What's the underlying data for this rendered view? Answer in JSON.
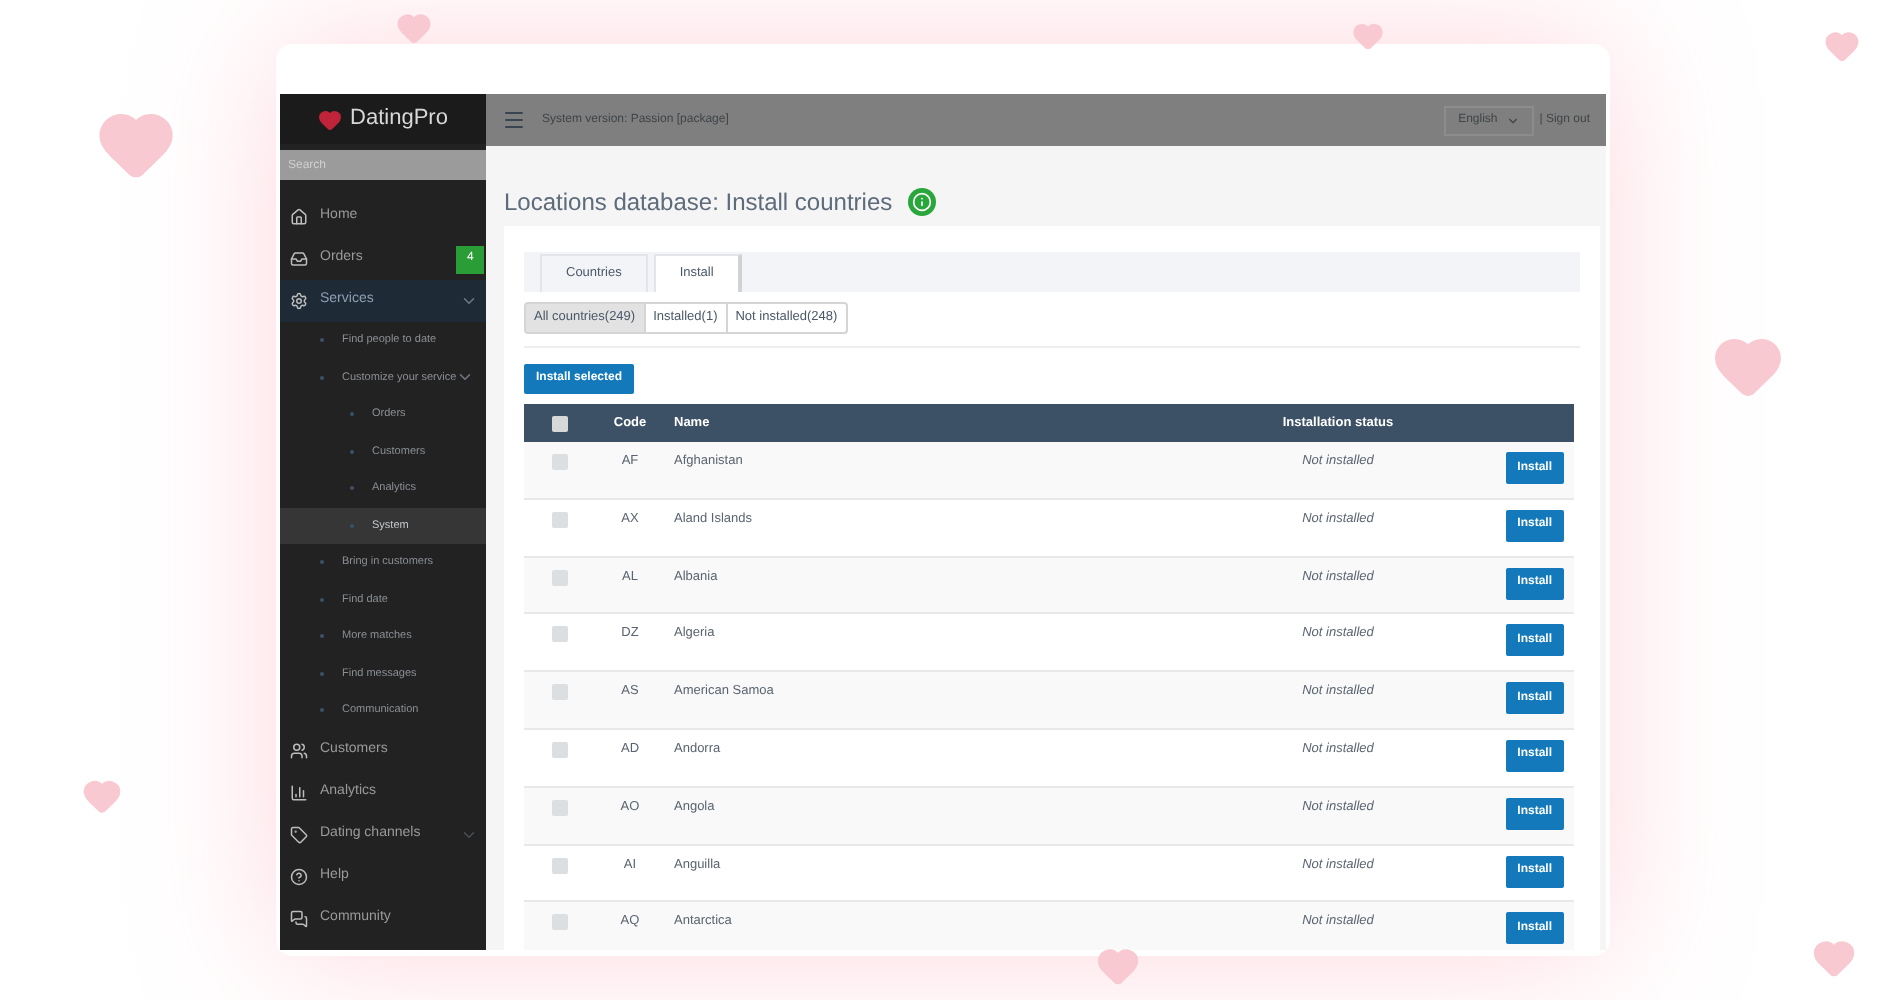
{
  "sidebar": {
    "logo": "DatingPro",
    "search": {
      "placeholder": "Search"
    },
    "items": [
      {
        "label": "Home",
        "selected": false
      },
      {
        "label": "Orders",
        "badge": "4",
        "selected": false
      },
      {
        "label": "Services",
        "selected": true,
        "expanded": true,
        "children": [
          {
            "label": "Find people to date",
            "selected": false
          },
          {
            "label": "Customize your service",
            "selected": false,
            "expanded": true,
            "children": [
              {
                "label": "Orders",
                "selected": false
              },
              {
                "label": "Customers",
                "selected": false
              },
              {
                "label": "Analytics",
                "selected": false
              },
              {
                "label": "System",
                "selected": true
              }
            ]
          },
          {
            "label": "Bring in customers",
            "selected": false
          },
          {
            "label": "Find date",
            "selected": false
          },
          {
            "label": "More matches",
            "selected": false
          },
          {
            "label": "Find messages",
            "selected": false
          },
          {
            "label": "Communication",
            "selected": false
          }
        ]
      },
      {
        "label": "Customers",
        "selected": false
      },
      {
        "label": "Analytics",
        "selected": false
      },
      {
        "label": "Dating channels",
        "selected": false,
        "expanded": false
      },
      {
        "label": "Help",
        "selected": false
      },
      {
        "label": "Community",
        "selected": false
      }
    ]
  },
  "top_bar": {
    "system_version": "System version: Passion [package]",
    "language": "English",
    "sign_out": "| Sign out"
  },
  "page_title": "Locations database: Install countries",
  "tabs": [
    {
      "label": "Countries",
      "selected": false
    },
    {
      "label": "Install",
      "selected": true
    }
  ],
  "filters": [
    {
      "label": "All countries(249)",
      "selected": true
    },
    {
      "label": "Installed(1)",
      "selected": false
    },
    {
      "label": "Not installed(248)",
      "selected": false
    }
  ],
  "install_selected": "Install selected",
  "table": {
    "columns": [
      "Code",
      "Name",
      "Installation status"
    ],
    "select_all_checked": false,
    "rows": [
      {
        "code": "AF",
        "name": "Afghanistan",
        "status": "Not installed",
        "action": "Install",
        "checked": false
      },
      {
        "code": "AX",
        "name": "Aland Islands",
        "status": "Not installed",
        "action": "Install",
        "checked": false
      },
      {
        "code": "AL",
        "name": "Albania",
        "status": "Not installed",
        "action": "Install",
        "checked": false
      },
      {
        "code": "DZ",
        "name": "Algeria",
        "status": "Not installed",
        "action": "Install",
        "checked": false
      },
      {
        "code": "AS",
        "name": "American Samoa",
        "status": "Not installed",
        "action": "Install",
        "checked": false
      },
      {
        "code": "AD",
        "name": "Andorra",
        "status": "Not installed",
        "action": "Install",
        "checked": false
      },
      {
        "code": "AO",
        "name": "Angola",
        "status": "Not installed",
        "action": "Install",
        "checked": false
      },
      {
        "code": "AI",
        "name": "Anguilla",
        "status": "Not installed",
        "action": "Install",
        "checked": false
      },
      {
        "code": "AQ",
        "name": "Antarctica",
        "status": "Not installed",
        "action": "Install",
        "checked": false
      }
    ]
  }
}
